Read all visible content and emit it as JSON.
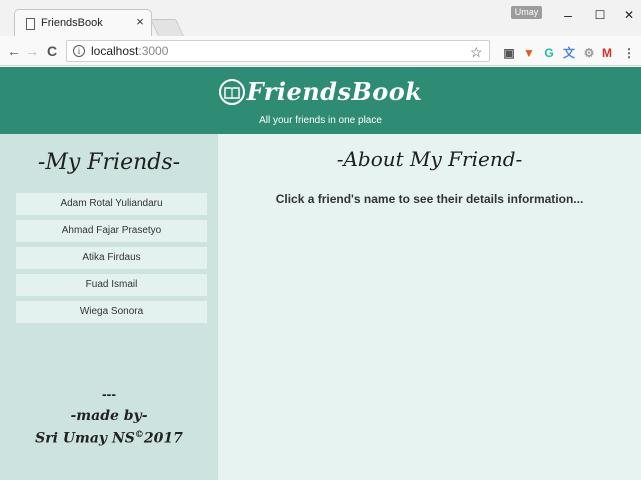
{
  "browser": {
    "tab_title": "FriendsBook",
    "tab_close": "×",
    "user_badge": "Umay",
    "window": {
      "minimize": "–",
      "maximize": "☐",
      "close": "✕"
    },
    "nav": {
      "back": "←",
      "forward": "→",
      "reload": "C"
    },
    "url_host": "localhost",
    "url_port": ":3000",
    "info_glyph": "i",
    "star_glyph": "☆",
    "extensions": [
      {
        "name": "pocket-extension-icon",
        "glyph": "▣",
        "color": "#555555"
      },
      {
        "name": "vivaldi-extension-icon",
        "glyph": "▼",
        "color": "#e8591a"
      },
      {
        "name": "grammarly-extension-icon",
        "glyph": "G",
        "color": "#15c39a"
      },
      {
        "name": "translate-extension-icon",
        "glyph": "文",
        "color": "#4a89dc"
      },
      {
        "name": "settings-extension-icon",
        "glyph": "⚙",
        "color": "#9a9a9a"
      },
      {
        "name": "gmail-extension-icon",
        "glyph": "M",
        "color": "#d93025"
      }
    ],
    "menu_glyph": "⋮"
  },
  "header": {
    "brand": "FriendsBook",
    "tagline": "All your friends in one place",
    "bg_color": "#2e8b74"
  },
  "sidebar": {
    "title": "-My Friends-",
    "friends": [
      "Adam Rotal Yuliandaru",
      "Ahmad Fajar Prasetyo",
      "Atika Firdaus",
      "Fuad Ismail",
      "Wiega Sonora"
    ],
    "footer_sep": "---",
    "footer_made": "-made by-",
    "footer_author": "Sri Umay NS",
    "footer_copy": "©",
    "footer_year": "2017"
  },
  "main": {
    "title": "-About My Friend-",
    "hint": "Click a friend's name to see their details information..."
  }
}
